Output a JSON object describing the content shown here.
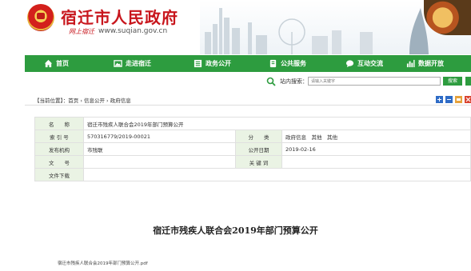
{
  "header": {
    "site_title": "宿迁市人民政府",
    "site_subtitle": "网上宿迁",
    "site_url": "www.suqian.gov.cn"
  },
  "nav": {
    "items": [
      {
        "label": "首页",
        "icon": "home-icon"
      },
      {
        "label": "走进宿迁",
        "icon": "picture-icon"
      },
      {
        "label": "政务公开",
        "icon": "document-icon"
      },
      {
        "label": "公共服务",
        "icon": "service-icon"
      },
      {
        "label": "互动交流",
        "icon": "chat-icon"
      },
      {
        "label": "数据开放",
        "icon": "data-icon"
      }
    ],
    "color": "#2d9c3f"
  },
  "search": {
    "label": "站内搜索：",
    "placeholder": "请输入关键字",
    "button_label": "搜索"
  },
  "breadcrumb": {
    "text": "【当前位置】：首页 › 信息公开 › 政府信息"
  },
  "info": {
    "name_label": "名　　称",
    "name_value": "宿迁市残疾人联合会2019年部门预算公开",
    "index_label": "索 引 号",
    "index_value": "570316779/2019-00021",
    "category_label": "分　　类",
    "category_value": "政府信息　其他　其他",
    "issuer_label": "发布机构",
    "issuer_value": "市残联",
    "date_label": "公开日期",
    "date_value": "2019-02-16",
    "docno_label": "文　　号",
    "docno_value": "",
    "keywords_label": "关 键 词",
    "keywords_value": "",
    "download_label": "文件下载",
    "download_value": ""
  },
  "article": {
    "title": "宿迁市残疾人联合会2019年部门预算公开",
    "attachment": "宿迁市残疾人联合会2019年部门预算公开.pdf"
  }
}
